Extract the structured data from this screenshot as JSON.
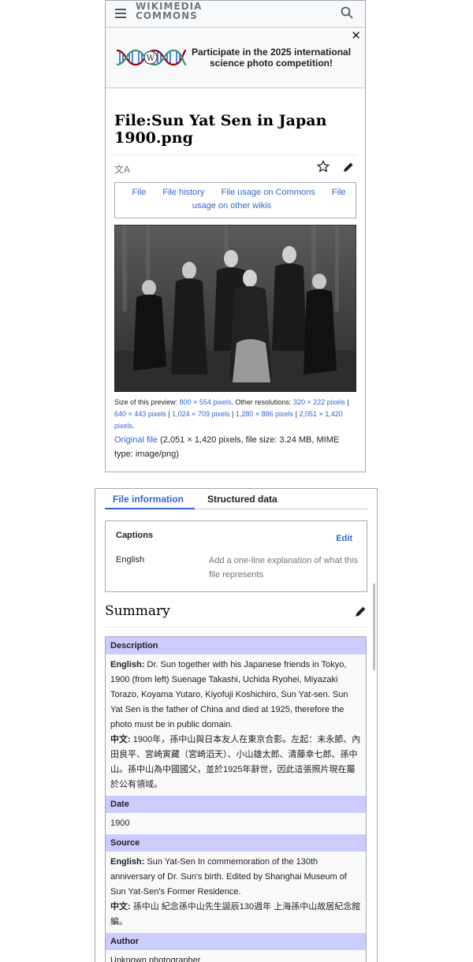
{
  "header": {
    "logo_line1": "WIKIMEDIA",
    "logo_line2": "COMMONS"
  },
  "banner": {
    "text": "Participate in the 2025 international science photo competition!"
  },
  "page": {
    "title": "File:Sun Yat Sen in Japan 1900.png"
  },
  "file_nav": {
    "file": "File",
    "history": "File history",
    "usage": "File usage on Commons",
    "other": "File usage on other wikis"
  },
  "preview": {
    "size_label": "Size of this preview:",
    "size_value": "800 × 554 pixels",
    "other_label": ". Other resolutions:",
    "res1": "320 × 222 pixels",
    "res2": "640 × 443 pixels",
    "res3": "1,024 × 709 pixels",
    "res4": "1,280 × 886 pixels",
    "res5": "2,051 × 1,420 pixels",
    "sep": " | ",
    "end": "."
  },
  "original": {
    "link": "Original file",
    "details": " (2,051 × 1,420 pixels, file size: 3.24 MB, MIME type: image/png)"
  },
  "tabs": {
    "info": "File information",
    "structured": "Structured data"
  },
  "captions": {
    "title": "Captions",
    "edit": "Edit",
    "lang": "English",
    "placeholder": "Add a one-line explanation of what this file represents"
  },
  "summary": {
    "title": "Summary",
    "desc_head": "Description",
    "desc_en_label": "English:",
    "desc_en": " Dr. Sun together with his Japanese friends in Tokyo, 1900 (from left) Suenage Takashi, Uchida Ryohei, Miyazaki Torazo, Koyama Yutaro, Kiyofuji Koshichiro, Sun Yat-sen. Sun Yat Sen is the father of China and died at 1925, therefore the photo must be in public domain.",
    "desc_zh_label": "中文:",
    "desc_zh": " 1900年，孫中山與日本友人在東京合影。左起：末永節、內田良平、宮崎寅藏（宮崎滔天）、小山雄太郎、清藤幸七郎、孫中山。孫中山為中國國父，並於1925年辭世，因此這張照片現在屬於公有領域。",
    "date_head": "Date",
    "date": "1900",
    "source_head": "Source",
    "source_en_label": "English:",
    "source_en": " Sun Yat-Sen In commemoration of the 130th anniversary of Dr. Sun's birth. Edited by Shanghai Museum of Sun Yat-Sen's Former Residence.",
    "source_zh_label": "中文:",
    "source_zh": " 孫中山 紀念孫中山先生誕辰130週年 上海孫中山故居紀念館編。",
    "author_head": "Author",
    "author": "Unknown photographer"
  },
  "icons": {
    "hamburger": "menu-icon",
    "search": "search-icon",
    "close": "close-icon",
    "translate": "translate-icon",
    "star": "star-icon",
    "pencil": "pencil-icon",
    "dna": "dna-logo-icon"
  },
  "colors": {
    "link": "#3366cc",
    "table_header": "#ccccff",
    "border": "#a2a9b1"
  }
}
